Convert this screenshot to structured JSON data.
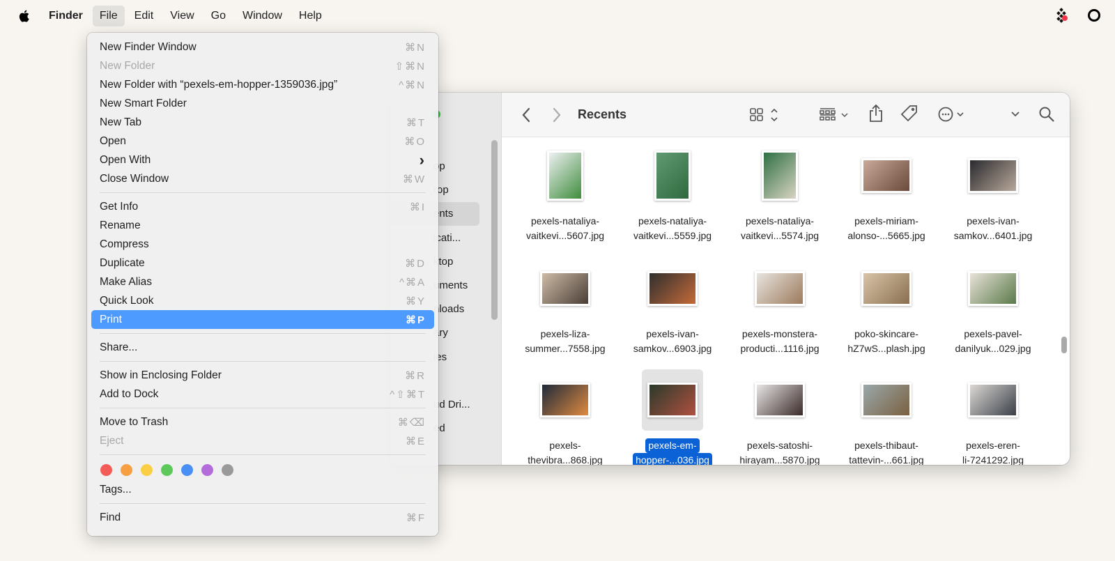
{
  "menubar": {
    "app": "Finder",
    "items": [
      "File",
      "Edit",
      "View",
      "Go",
      "Window",
      "Help"
    ],
    "active": "File"
  },
  "file_menu": {
    "groups": [
      [
        {
          "label": "New Finder Window",
          "shortcut": "⌘N",
          "enabled": true
        },
        {
          "label": "New Folder",
          "shortcut": "⇧⌘N",
          "enabled": false
        },
        {
          "label": "New Folder with “pexels-em-hopper-1359036.jpg”",
          "shortcut": "^⌘N",
          "enabled": true
        },
        {
          "label": "New Smart Folder",
          "shortcut": "",
          "enabled": true
        },
        {
          "label": "New Tab",
          "shortcut": "⌘T",
          "enabled": true
        },
        {
          "label": "Open",
          "shortcut": "⌘O",
          "enabled": true
        },
        {
          "label": "Open With",
          "shortcut": "›",
          "enabled": true
        },
        {
          "label": "Close Window",
          "shortcut": "⌘W",
          "enabled": true
        }
      ],
      [
        {
          "label": "Get Info",
          "shortcut": "⌘I",
          "enabled": true
        },
        {
          "label": "Rename",
          "shortcut": "",
          "enabled": true
        },
        {
          "label": "Compress",
          "shortcut": "",
          "enabled": true
        },
        {
          "label": "Duplicate",
          "shortcut": "⌘D",
          "enabled": true
        },
        {
          "label": "Make Alias",
          "shortcut": "^⌘A",
          "enabled": true
        },
        {
          "label": "Quick Look",
          "shortcut": "⌘Y",
          "enabled": true
        },
        {
          "label": "Print",
          "shortcut": "⌘P",
          "enabled": true,
          "highlighted": true
        }
      ],
      [
        {
          "label": "Share...",
          "shortcut": "",
          "enabled": true
        }
      ],
      [
        {
          "label": "Show in Enclosing Folder",
          "shortcut": "⌘R",
          "enabled": true
        },
        {
          "label": "Add to Dock",
          "shortcut": "^⇧⌘T",
          "enabled": true
        }
      ],
      [
        {
          "label": "Move to Trash",
          "shortcut": "⌘⌫",
          "enabled": true
        },
        {
          "label": "Eject",
          "shortcut": "⌘E",
          "enabled": false
        }
      ]
    ],
    "tag_colors": [
      "#f45c58",
      "#f7a043",
      "#fbcf45",
      "#5dc95a",
      "#4a8ff5",
      "#b46cdb",
      "#9a9a9a"
    ],
    "tags_label": "Tags...",
    "find": {
      "label": "Find",
      "shortcut": "⌘F"
    }
  },
  "finder": {
    "title": "Recents",
    "sidebar_items": [
      "op",
      "rop",
      "ents",
      "icati...",
      "ktop",
      "uments",
      "nloads",
      "ary",
      "ies",
      "",
      "ud Dri...",
      "ed"
    ],
    "sidebar_selected": 2,
    "files": [
      {
        "l1": "pexels-nataliya-",
        "l2": "vaitkevi...5607.jpg",
        "shape": "portrait",
        "c1": "#eef0f2",
        "c2": "#3f8d3c"
      },
      {
        "l1": "pexels-nataliya-",
        "l2": "vaitkevi...5559.jpg",
        "shape": "portrait",
        "c1": "#5f9a72",
        "c2": "#2f6a3e"
      },
      {
        "l1": "pexels-nataliya-",
        "l2": "vaitkevi...5574.jpg",
        "shape": "portrait",
        "c1": "#2f7044",
        "c2": "#d9d4c2"
      },
      {
        "l1": "pexels-miriam-",
        "l2": "alonso-...5665.jpg",
        "shape": "landscape",
        "c1": "#c9a99a",
        "c2": "#6a4a3a"
      },
      {
        "l1": "pexels-ivan-",
        "l2": "samkov...6401.jpg",
        "shape": "landscape",
        "c1": "#2a2a2e",
        "c2": "#b8a89a"
      },
      {
        "l1": "pexels-liza-",
        "l2": "summer...7558.jpg",
        "shape": "landscape",
        "c1": "#cdbba6",
        "c2": "#4a3e36"
      },
      {
        "l1": "pexels-ivan-",
        "l2": "samkov...6903.jpg",
        "shape": "landscape",
        "c1": "#2f2f2f",
        "c2": "#c56a38"
      },
      {
        "l1": "pexels-monstera-",
        "l2": "producti...1116.jpg",
        "shape": "landscape",
        "c1": "#e8e4df",
        "c2": "#9c7a5c"
      },
      {
        "l1": "poko-skincare-",
        "l2": "hZ7wS...plash.jpg",
        "shape": "landscape",
        "c1": "#d9c4a8",
        "c2": "#8a6f50"
      },
      {
        "l1": "pexels-pavel-",
        "l2": "danilyuk...029.jpg",
        "shape": "landscape",
        "c1": "#e8e2d8",
        "c2": "#5a7a4a"
      },
      {
        "l1": "pexels-",
        "l2": "thevibra...868.jpg",
        "shape": "landscape",
        "c1": "#1e2a3a",
        "c2": "#e08a40"
      },
      {
        "l1": "pexels-em-",
        "l2": "hopper-...036.jpg",
        "shape": "landscape",
        "c1": "#2a3a2a",
        "c2": "#b05040",
        "selected": true
      },
      {
        "l1": "pexels-satoshi-",
        "l2": "hirayam...5870.jpg",
        "shape": "landscape",
        "c1": "#e8e6e6",
        "c2": "#3a2a28"
      },
      {
        "l1": "pexels-thibaut-",
        "l2": "tattevin-...661.jpg",
        "shape": "landscape",
        "c1": "#9aa8aa",
        "c2": "#7a6040"
      },
      {
        "l1": "pexels-eren-",
        "l2": "li-7241292.jpg",
        "shape": "landscape",
        "c1": "#dcd8d4",
        "c2": "#3a4048"
      }
    ]
  }
}
